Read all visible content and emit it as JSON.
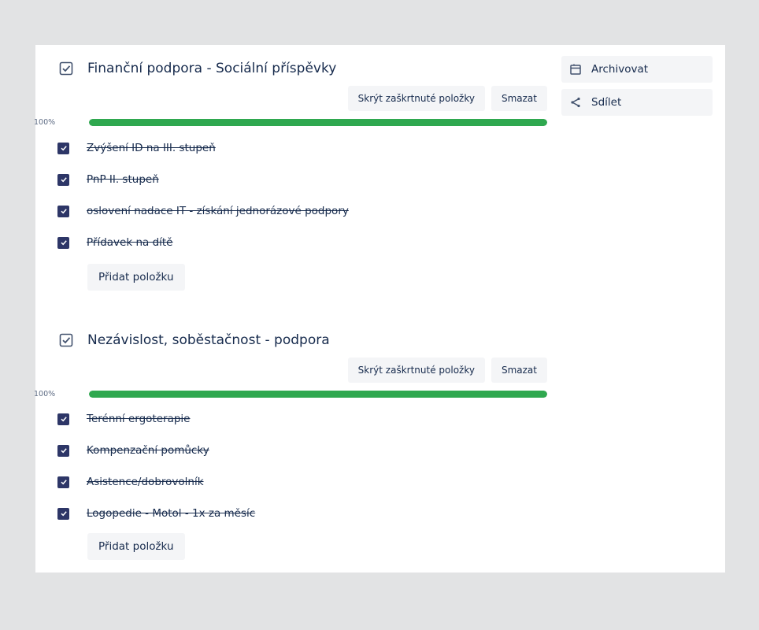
{
  "checklists": [
    {
      "title": "Finanční podpora - Sociální příspěvky",
      "hide_checked_label": "Skrýt zaškrtnuté položky",
      "delete_label": "Smazat",
      "progress_percent": 100,
      "progress_label": "100%",
      "items": [
        {
          "text": "Zvýšení ID na III. stupeň",
          "checked": true
        },
        {
          "text": "PnP II. stupeň",
          "checked": true
        },
        {
          "text": "oslovení nadace IT - získání jednorázové podpory",
          "checked": true
        },
        {
          "text": "Přídavek na dítě",
          "checked": true
        }
      ],
      "add_item_label": "Přidat položku"
    },
    {
      "title": "Nezávislost, soběstačnost - podpora",
      "hide_checked_label": "Skrýt zaškrtnuté položky",
      "delete_label": "Smazat",
      "progress_percent": 100,
      "progress_label": "100%",
      "items": [
        {
          "text": "Terénní ergoterapie",
          "checked": true
        },
        {
          "text": "Kompenzační pomůcky",
          "checked": true
        },
        {
          "text": "Asistence/dobrovolník",
          "checked": true
        },
        {
          "text": "Logopedie - Motol - 1x za měsíc",
          "checked": true
        }
      ],
      "add_item_label": "Přidat položku"
    }
  ],
  "sidebar": {
    "archive_label": "Archivovat",
    "archive_icon": "archive-icon",
    "share_label": "Sdílet",
    "share_icon": "share-icon"
  },
  "colors": {
    "progress_fill": "#2fa84f",
    "checkbox": "#2d3667",
    "button_bg": "#f4f5f7",
    "text": "#172b4d"
  }
}
